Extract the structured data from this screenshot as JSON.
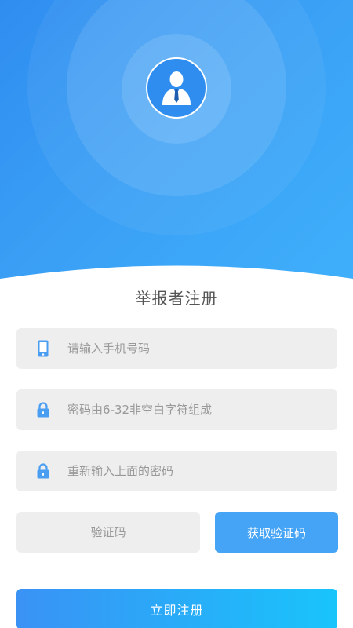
{
  "header": {
    "avatar_icon": "user-tie-icon",
    "accent": "#2f8df0"
  },
  "title": "举报者注册",
  "form": {
    "phone": {
      "icon": "phone-icon",
      "placeholder": "请输入手机号码",
      "value": ""
    },
    "password": {
      "icon": "lock-icon",
      "placeholder": "密码由6-32非空白字符组成",
      "value": ""
    },
    "confirm_password": {
      "icon": "lock-icon",
      "placeholder": "重新输入上面的密码",
      "value": ""
    },
    "code": {
      "placeholder": "验证码",
      "value": ""
    },
    "get_code_label": "获取验证码",
    "submit_label": "立即注册"
  },
  "colors": {
    "primary": "#46a4f6",
    "field_bg": "#eeeeee",
    "icon": "#4a9ef2"
  }
}
